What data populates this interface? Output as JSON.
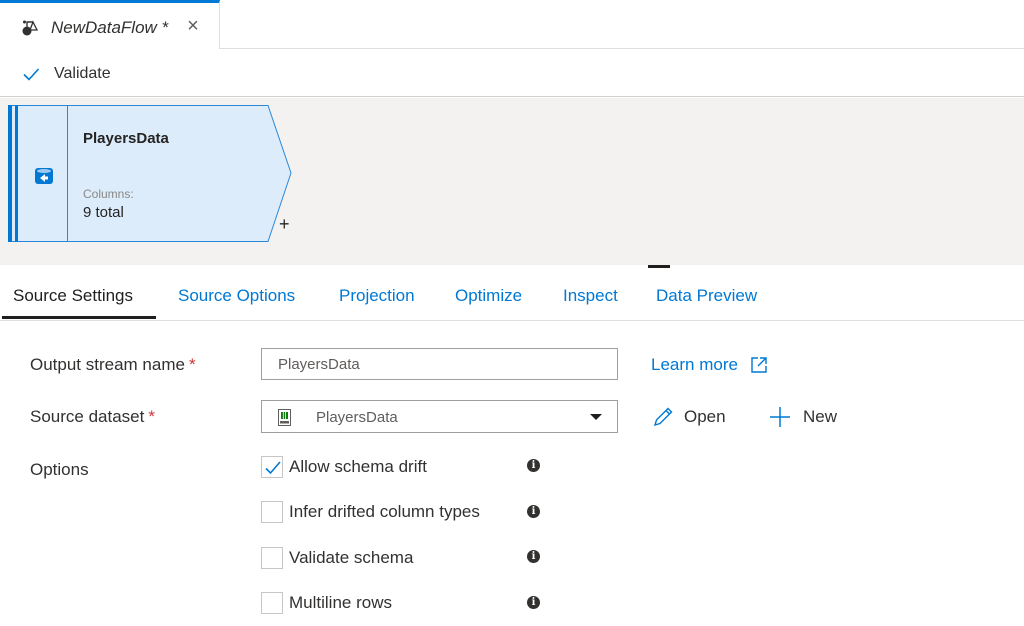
{
  "document_tab": {
    "title": "NewDataFlow *",
    "icon": "dataflow-icon",
    "close_icon": "close-icon"
  },
  "toolbar": {
    "validate_label": "Validate",
    "validate_icon": "checkmark-icon"
  },
  "canvas": {
    "node": {
      "name": "PlayersData",
      "columns_label": "Columns:",
      "columns_value": "9 total",
      "icon": "source-icon",
      "add_label": "+"
    }
  },
  "settings_tabs": [
    {
      "label": "Source Settings",
      "active": true
    },
    {
      "label": "Source Options",
      "active": false
    },
    {
      "label": "Projection",
      "active": false
    },
    {
      "label": "Optimize",
      "active": false
    },
    {
      "label": "Inspect",
      "active": false
    },
    {
      "label": "Data Preview",
      "active": false
    }
  ],
  "form": {
    "output_stream": {
      "label": "Output stream name",
      "required_mark": "*",
      "value": "PlayersData",
      "learn_more": "Learn more"
    },
    "source_dataset": {
      "label": "Source dataset",
      "required_mark": "*",
      "value": "PlayersData",
      "open_label": "Open",
      "new_label": "New"
    },
    "options": {
      "label": "Options",
      "items": [
        {
          "label": "Allow schema drift",
          "checked": true
        },
        {
          "label": "Infer drifted column types",
          "checked": false
        },
        {
          "label": "Validate schema",
          "checked": false
        },
        {
          "label": "Multiline rows",
          "checked": false
        }
      ]
    }
  },
  "colors": {
    "accent": "#0078d4",
    "node_fill": "#dcecfb",
    "canvas_bg": "#f3f2f1",
    "required": "#d13438"
  }
}
